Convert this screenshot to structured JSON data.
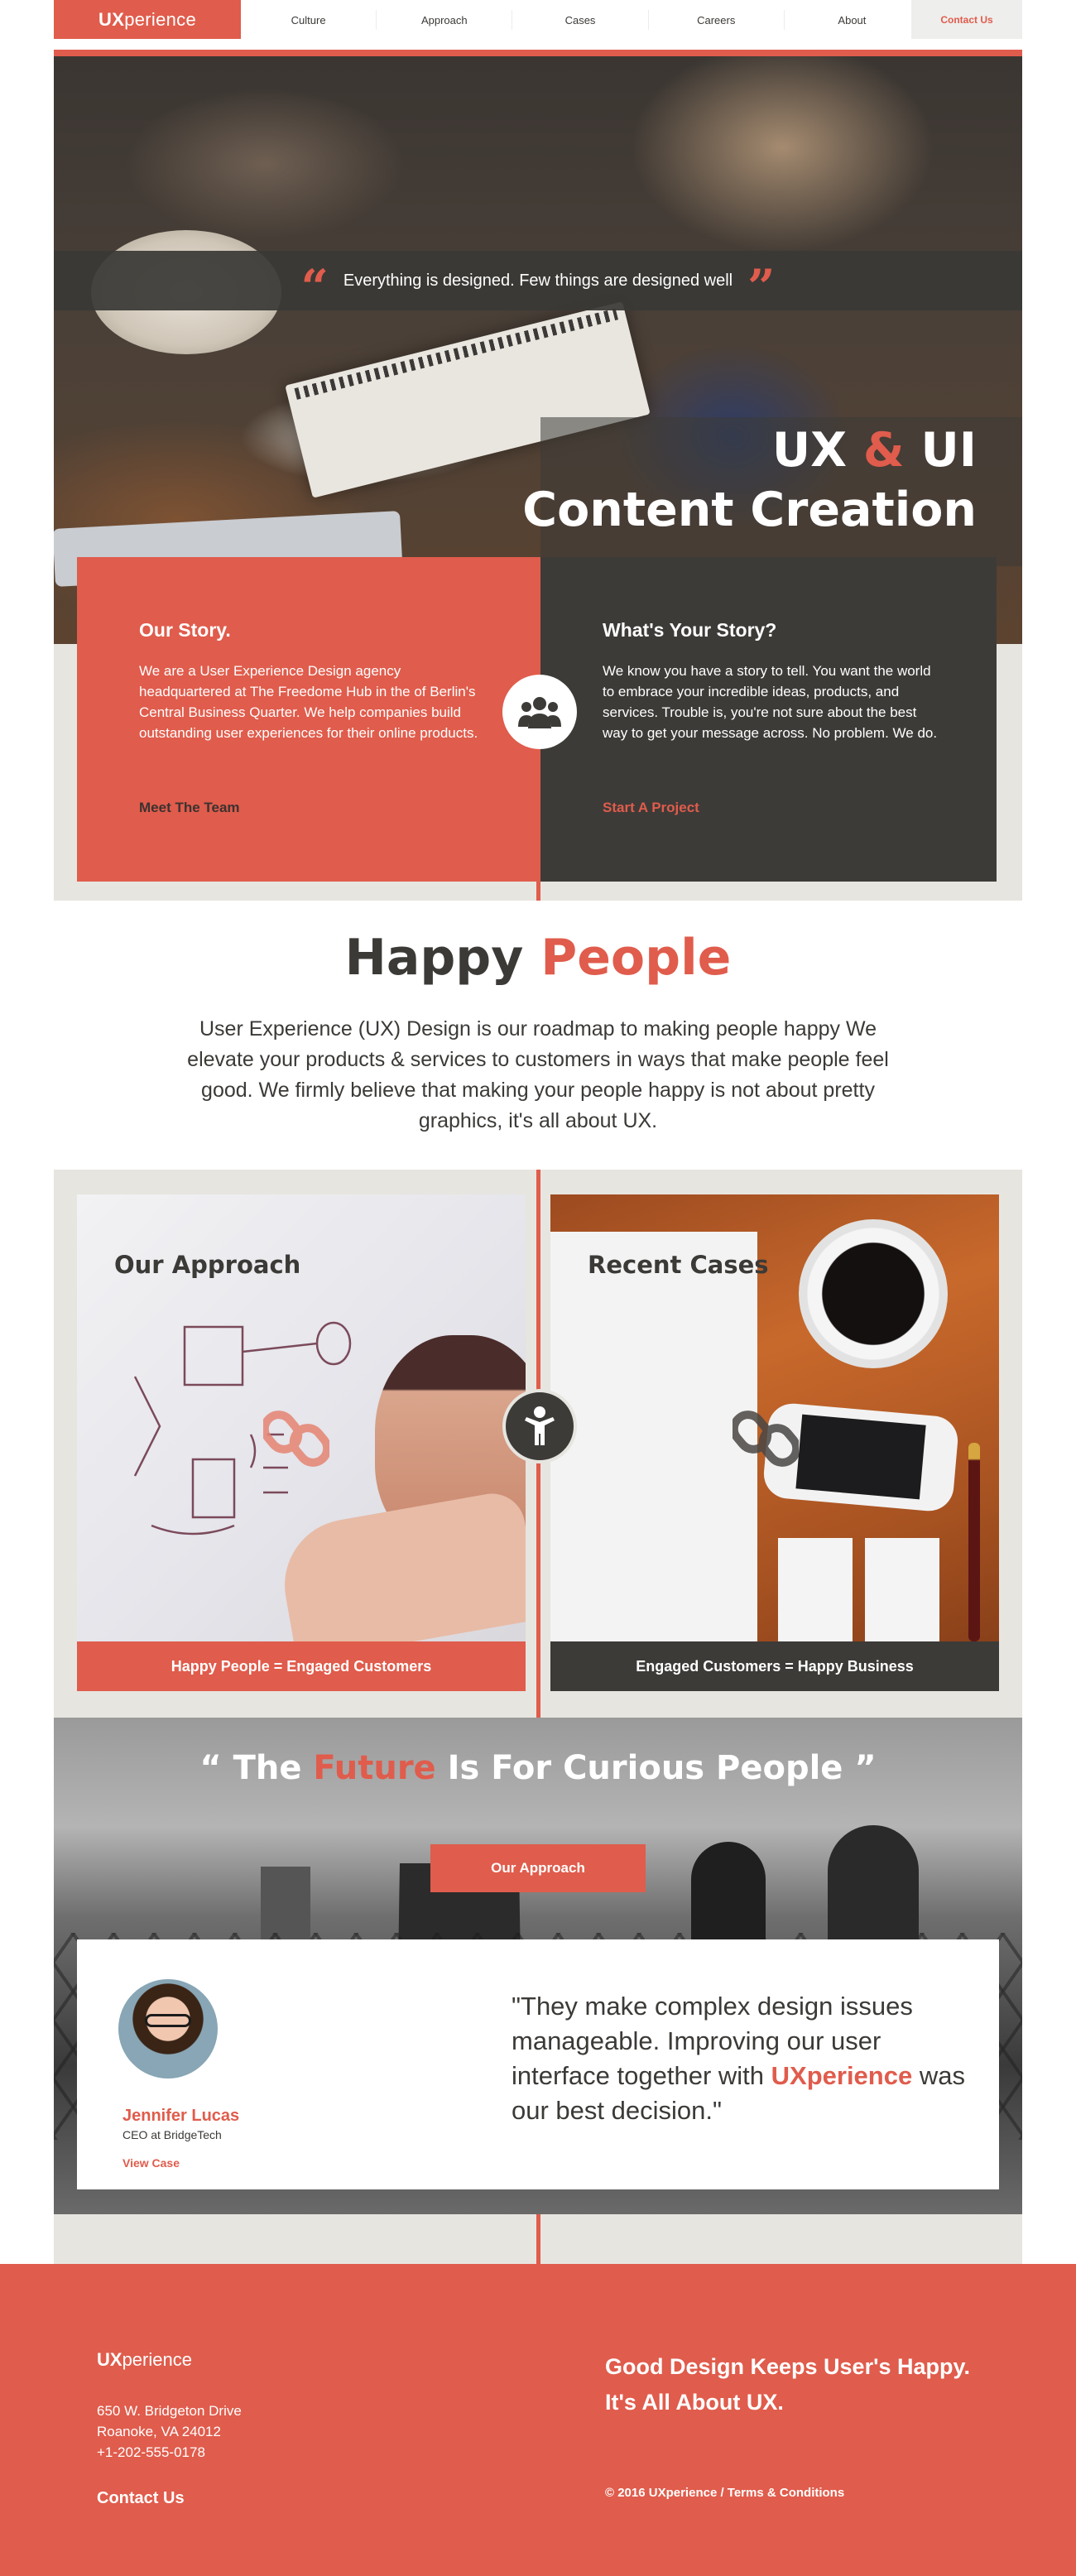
{
  "nav": {
    "logo_bold": "UX",
    "logo_rest": "perience",
    "items": [
      "Culture",
      "Approach",
      "Cases",
      "Careers",
      "About"
    ],
    "contact": "Contact Us"
  },
  "hero": {
    "quote": "Everything is designed. Few things are designed well",
    "title_ux": "UX",
    "title_amp": "&",
    "title_ui": "UI",
    "title_line2": "Content Creation"
  },
  "story": {
    "left_title": "Our Story.",
    "left_text": "We are a User Experience Design agency headquartered at The Freedome Hub in the of Berlin's Central Business Quarter. We help companies build outstanding user experiences for their online products.",
    "left_link": "Meet The Team",
    "right_title": "What's Your Story?",
    "right_text": "We know you have a story to tell. You want the world to embrace your incredible ideas, products, and services. Trouble is, you're not sure about the best way to get your message across. No problem. We do.",
    "right_link": "Start A Project",
    "icon": "users-group-icon"
  },
  "happy": {
    "title_a": "Happy",
    "title_b": "People",
    "text": "User Experience (UX) Design is our roadmap to making people happy We elevate your products & services to customers in ways that make people feel good. We firmly believe that making your people happy is not about pretty graphics, it's all about UX."
  },
  "cards": {
    "left_title": "Our Approach",
    "left_bar": "Happy People = Engaged Customers",
    "right_title": "Recent Cases",
    "right_bar": "Engaged Customers = Happy Business",
    "center_icon": "person-icon",
    "link_icon": "chain-link-icon"
  },
  "future": {
    "open_quote": "“ The",
    "highlight": "Future",
    "rest": "Is For Curious People ”",
    "button": "Our Approach"
  },
  "testimonial": {
    "name": "Jennifer Lucas",
    "role": "CEO at BridgeTech",
    "view": "View Case",
    "quote_a": "\"They make complex design issues manageable. Improving our user interface together with",
    "quote_brand": "UXperience",
    "quote_b": "was our best decision.\""
  },
  "footer": {
    "logo_bold": "UX",
    "logo_rest": "perience",
    "address_1": "650 W. Bridgeton Drive",
    "address_2": "Roanoke, VA 24012",
    "phone": "+1-202-555-0178",
    "contact": "Contact Us",
    "tagline_1": "Good Design Keeps User's Happy.",
    "tagline_2": "It's All About UX.",
    "copyright": "© 2016 UXperience / Terms & Conditions"
  },
  "colors": {
    "accent": "#e05c4c",
    "dark": "#3d3b38",
    "beige": "#e7e5e0"
  }
}
